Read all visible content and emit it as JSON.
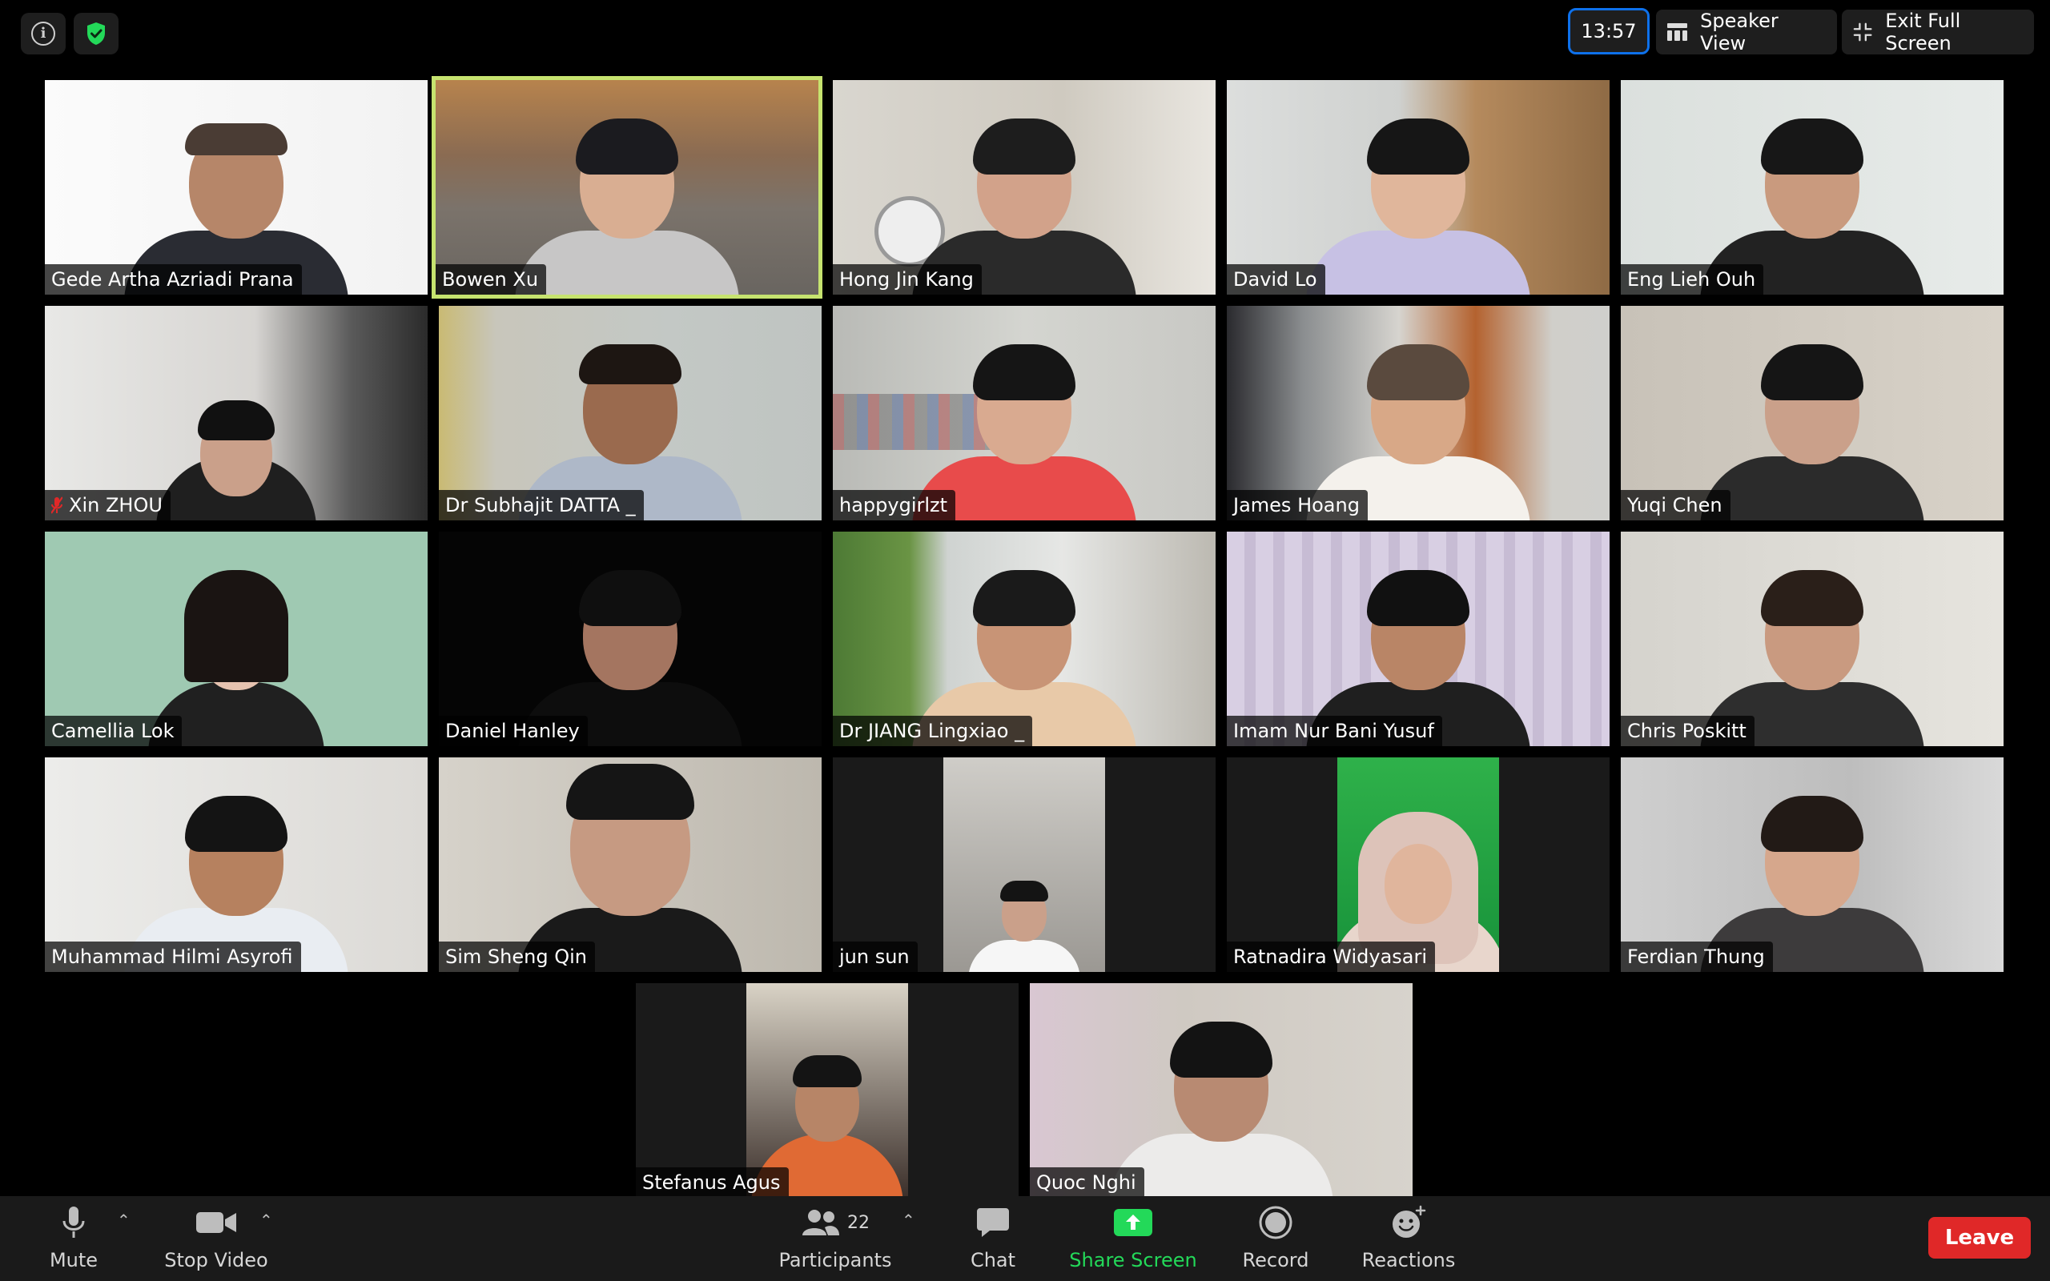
{
  "topbar": {
    "timer": "13:57",
    "speaker_view": "Speaker View",
    "exit_full_screen": "Exit Full Screen"
  },
  "participants": [
    {
      "name": "Gede Artha Azriadi Prana",
      "muted": false
    },
    {
      "name": "Bowen Xu",
      "muted": false,
      "active_speaker": true
    },
    {
      "name": "Hong Jin Kang",
      "muted": false
    },
    {
      "name": "David Lo",
      "muted": false
    },
    {
      "name": "Eng Lieh Ouh",
      "muted": false
    },
    {
      "name": "Xin ZHOU",
      "muted": true
    },
    {
      "name": "Dr Subhajit DATTA _",
      "muted": false
    },
    {
      "name": "happygirlzt",
      "muted": false
    },
    {
      "name": "James Hoang",
      "muted": false
    },
    {
      "name": "Yuqi Chen",
      "muted": false
    },
    {
      "name": "Camellia Lok",
      "muted": false
    },
    {
      "name": "Daniel Hanley",
      "muted": false
    },
    {
      "name": "Dr JIANG Lingxiao _",
      "muted": false
    },
    {
      "name": "Imam Nur Bani Yusuf",
      "muted": false
    },
    {
      "name": "Chris Poskitt",
      "muted": false
    },
    {
      "name": "Muhammad Hilmi Asyrofi",
      "muted": false
    },
    {
      "name": "Sim Sheng Qin",
      "muted": false
    },
    {
      "name": "jun sun",
      "muted": false
    },
    {
      "name": "Ratnadira Widyasari",
      "muted": false
    },
    {
      "name": "Ferdian Thung",
      "muted": false
    },
    {
      "name": "Stefanus Agus",
      "muted": false
    },
    {
      "name": "Quoc Nghi",
      "muted": false
    }
  ],
  "toolbar": {
    "mute": "Mute",
    "stop_video": "Stop Video",
    "participants": "Participants",
    "participants_count": "22",
    "chat": "Chat",
    "share_screen": "Share Screen",
    "record": "Record",
    "reactions": "Reactions",
    "leave": "Leave"
  },
  "colors": {
    "active_speaker_border": "#c6e36f",
    "share_screen": "#23d959",
    "leave": "#e02828",
    "timer_border": "#0e71eb"
  }
}
